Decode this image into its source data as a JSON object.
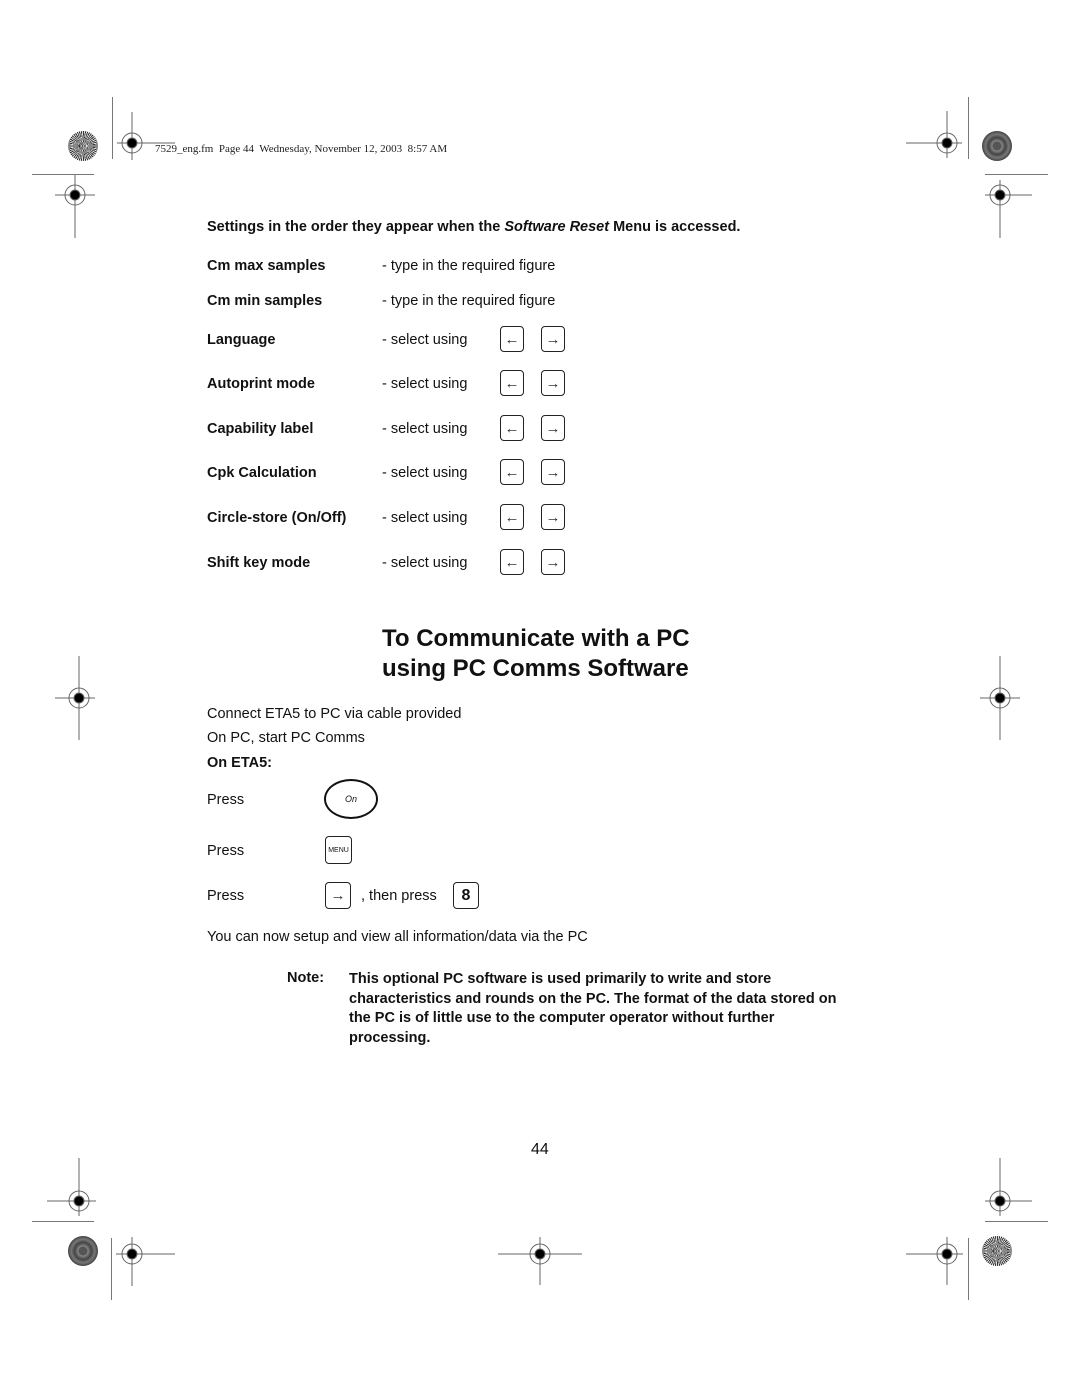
{
  "header": {
    "file_info": "7529_eng.fm  Page 44  Wednesday, November 12, 2003  8:57 AM"
  },
  "intro": {
    "prefix": "Settings in the order they appear when the ",
    "emphasis": "Software Reset",
    "suffix": " Menu is accessed."
  },
  "settings": [
    {
      "label": "Cm max samples",
      "desc": "- type in the required figure"
    },
    {
      "label": "Cm min samples",
      "desc": "- type in the required figure"
    },
    {
      "label": "Language",
      "desc": "- select using",
      "keys": [
        "←",
        "→"
      ]
    },
    {
      "label": "Autoprint mode",
      "desc": "- select using",
      "keys": [
        "←",
        "→"
      ]
    },
    {
      "label": "Capability label",
      "desc": "- select using",
      "keys": [
        "←",
        "→"
      ]
    },
    {
      "label": "Cpk Calculation",
      "desc": "- select using",
      "keys": [
        "←",
        "→"
      ]
    },
    {
      "label": "Circle-store (On/Off)",
      "desc": "- select using",
      "keys": [
        "←",
        "→"
      ]
    },
    {
      "label": "Shift key mode",
      "desc": "- select using",
      "keys": [
        "←",
        "→"
      ]
    }
  ],
  "section": {
    "title_line1": "To Communicate with a PC",
    "title_line2": "using PC Comms Software",
    "step1": "Connect ETA5 to PC via cable provided",
    "step2": "On PC, start PC Comms",
    "on_device": "On ETA5:",
    "press_label": "Press",
    "on_key": "On",
    "menu_key": "MENU",
    "right_key": "→",
    "then_press": ", then press",
    "eight_key": "8",
    "result": "You can now setup and view all information/data via the PC"
  },
  "note": {
    "label": "Note:",
    "text": "This optional PC software is used primarily to write and store characteristics and rounds on the PC. The format of the data stored on the PC is of little use to the computer operator without further processing."
  },
  "page_number": "44"
}
